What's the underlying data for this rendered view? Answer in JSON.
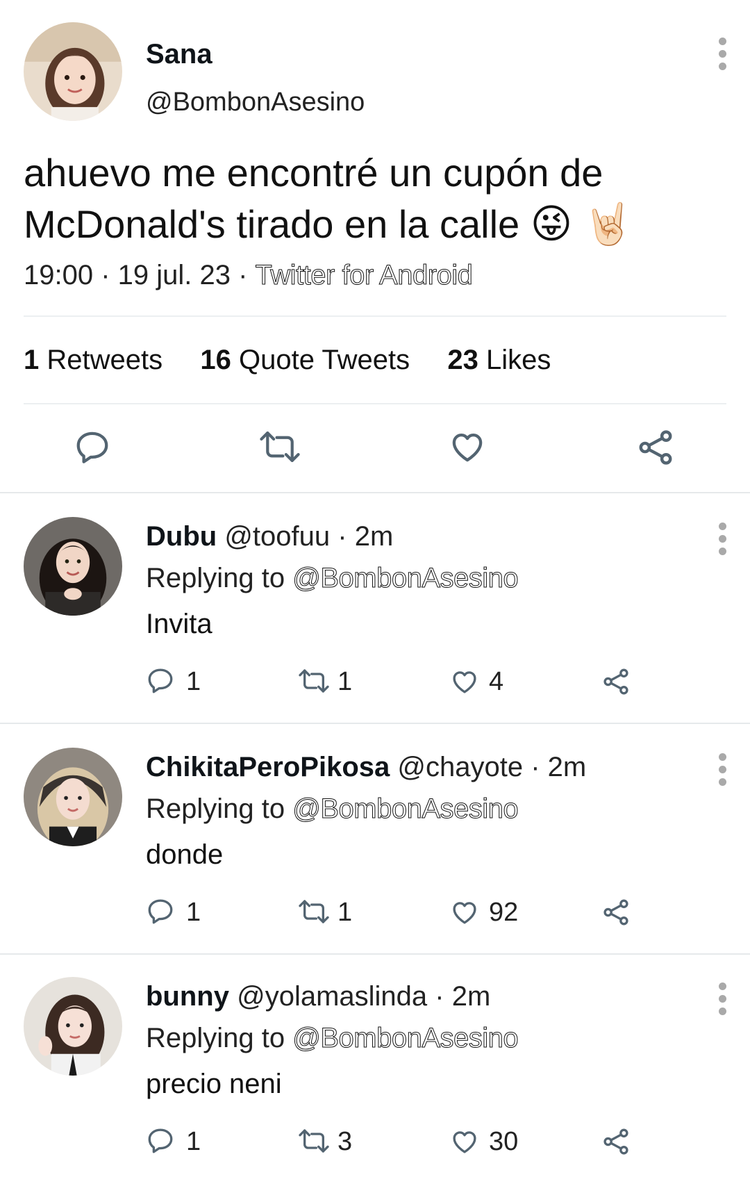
{
  "main_tweet": {
    "display_name": "Sana",
    "handle": "@BombonAsesino",
    "text_line1": "ahuevo me encontré un cupón de",
    "text_line2": "McDonald's tirado en la calle",
    "emoji1": "😜",
    "emoji2": "🤘🏻",
    "time_date": "19:00 · 19 jul. 23 · ",
    "source": "Twitter for Android",
    "stats": {
      "retweets_count": "1",
      "retweets_label": "Retweets",
      "quotes_count": "16",
      "quotes_label": "Quote Tweets",
      "likes_count": "23",
      "likes_label": "Likes"
    }
  },
  "replies": [
    {
      "display_name": "Dubu",
      "handle": "@toofuu",
      "time": "· 2m",
      "replying_prefix": "Replying to",
      "replying_to": "@BombonAsesino",
      "text": "Invita",
      "reply_count": "1",
      "retweet_count": "1",
      "like_count": "4"
    },
    {
      "display_name": "ChikitaPeroPikosa",
      "handle": "@chayote",
      "time": "· 2m",
      "replying_prefix": "Replying to",
      "replying_to": "@BombonAsesino",
      "text": "donde",
      "reply_count": "1",
      "retweet_count": "1",
      "like_count": "92"
    },
    {
      "display_name": "bunny",
      "handle": "@yolamaslinda",
      "time": "· 2m",
      "replying_prefix": "Replying to",
      "replying_to": "@BombonAsesino",
      "text": "precio neni",
      "reply_count": "1",
      "retweet_count": "3",
      "like_count": "30"
    }
  ],
  "icons": {
    "reply": "speech-bubble-icon",
    "retweet": "retweet-arrows-icon",
    "like": "heart-icon",
    "share": "share-nodes-icon",
    "more": "more-vertical-icon"
  },
  "colors": {
    "icon_gray": "#536471",
    "divider": "#eceff1",
    "text": "#0f1419"
  }
}
